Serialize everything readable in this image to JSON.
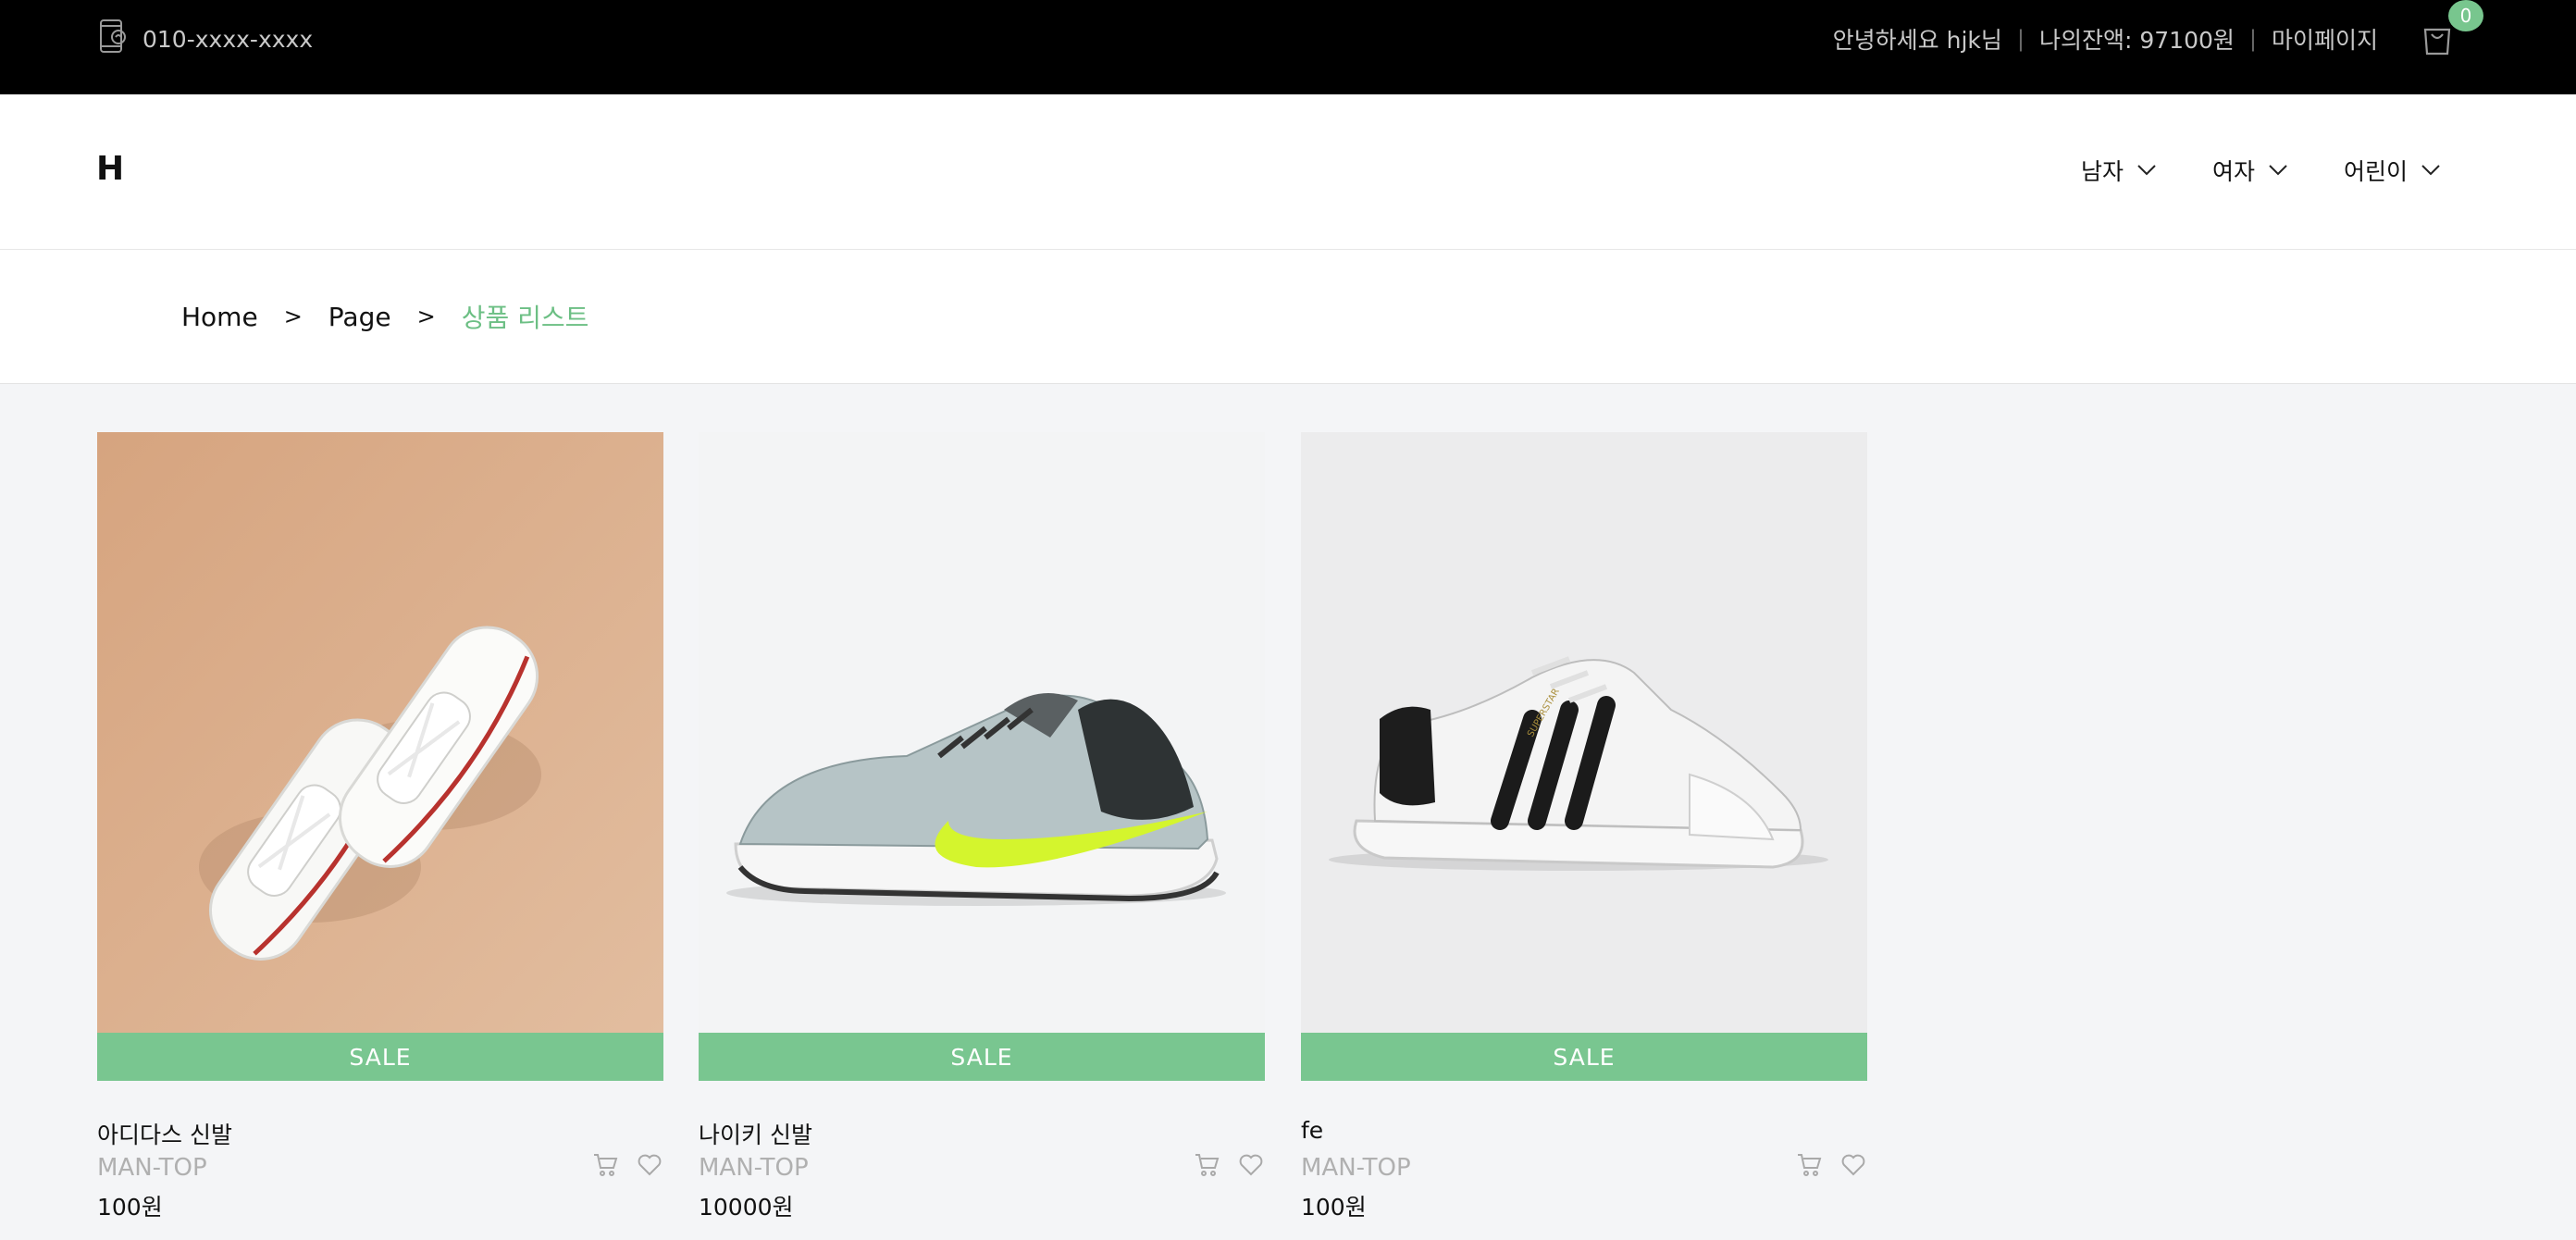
{
  "topbar": {
    "phone": "010-xxxx-xxxx",
    "greeting": "안녕하세요 hjk님",
    "balance": "나의잔액: 97100원",
    "mypage": "마이페이지",
    "cart_count": "0"
  },
  "header": {
    "logo": "H",
    "nav": [
      {
        "label": "남자"
      },
      {
        "label": "여자"
      },
      {
        "label": "어린이"
      }
    ]
  },
  "breadcrumb": {
    "items": [
      "Home",
      "Page"
    ],
    "current": "상품 리스트"
  },
  "products": [
    {
      "sale_label": "SALE",
      "name": "아디다스 신발",
      "category": "MAN-TOP",
      "price": "100원"
    },
    {
      "sale_label": "SALE",
      "name": "나이키 신발",
      "category": "MAN-TOP",
      "price": "10000원"
    },
    {
      "sale_label": "SALE",
      "name": "fe",
      "category": "MAN-TOP",
      "price": "100원"
    }
  ],
  "icons": {
    "phone": "phone-icon",
    "cart": "shopping-bag-icon",
    "nav_chevron": "chevron-down-icon",
    "add_to_cart": "cart-icon",
    "wishlist": "heart-icon"
  },
  "colors": {
    "accent": "#79c690",
    "topbar_bg": "#000000",
    "page_bg": "#f4f5f7"
  }
}
